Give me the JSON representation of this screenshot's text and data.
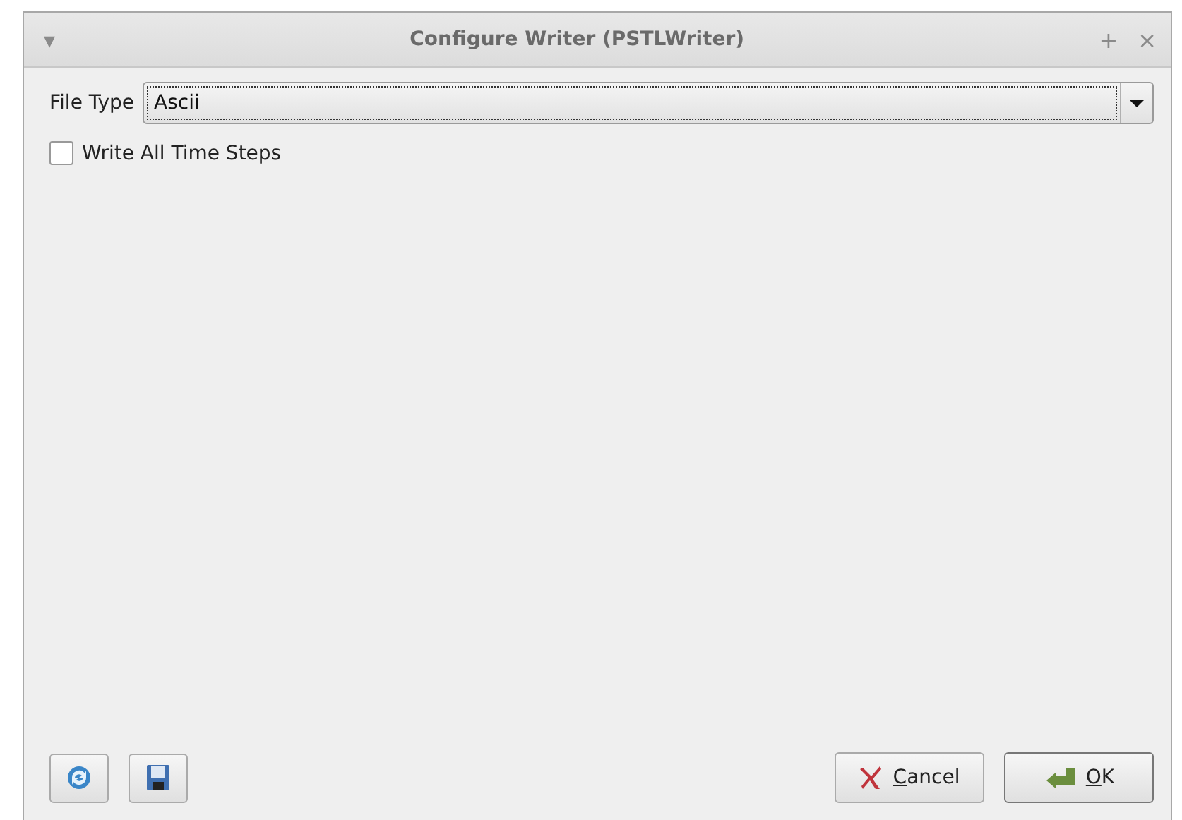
{
  "window": {
    "title": "Configure Writer (PSTLWriter)",
    "menu_glyph": "▾",
    "pin_glyph": "+",
    "close_glyph": "×"
  },
  "file_type": {
    "label": "File Type",
    "value": "Ascii"
  },
  "write_all_time_steps": {
    "label": "Write All Time Steps",
    "checked": false
  },
  "buttons": [
    {
      "kind": "cancel",
      "mnemonic": "C",
      "rest": "ancel"
    },
    {
      "kind": "ok",
      "mnemonic": "O",
      "rest": "K"
    }
  ]
}
